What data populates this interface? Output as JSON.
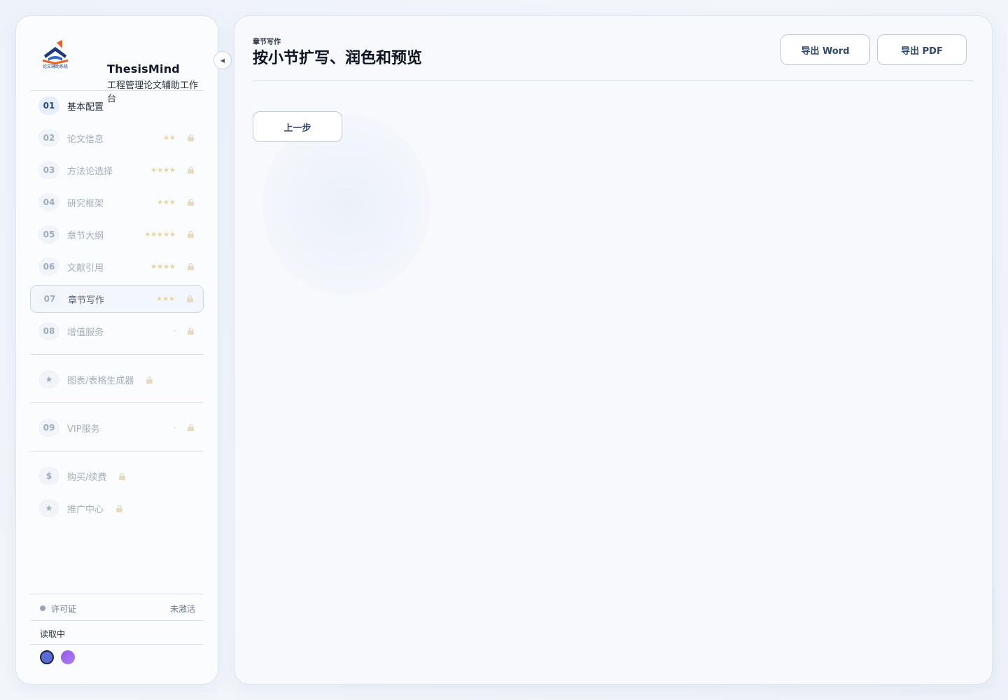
{
  "brand": {
    "title": "ThesisMind",
    "subtitle": "工程管理论文辅助工作台",
    "logo_text": "论文辅助系统"
  },
  "sidebar": {
    "collapse_icon": "chevron-left-icon",
    "steps": [
      {
        "num": "01",
        "label": "基本配置",
        "stars": "",
        "locked": false
      },
      {
        "num": "02",
        "label": "论文信息",
        "stars": "★★",
        "locked": true
      },
      {
        "num": "03",
        "label": "方法论选择",
        "stars": "★★★★",
        "locked": true
      },
      {
        "num": "04",
        "label": "研究框架",
        "stars": "★★★",
        "locked": true
      },
      {
        "num": "05",
        "label": "章节大纲",
        "stars": "★★★★★",
        "locked": true
      },
      {
        "num": "06",
        "label": "文献引用",
        "stars": "★★★★",
        "locked": true
      },
      {
        "num": "07",
        "label": "章节写作",
        "stars": "★★★",
        "locked": true
      },
      {
        "num": "08",
        "label": "增值服务",
        "chevron": "›",
        "locked": true
      }
    ],
    "tools": [
      {
        "icon": "★",
        "label": "图表/表格生成器",
        "locked": true
      }
    ],
    "vip": {
      "num": "09",
      "label": "VIP服务",
      "chevron": "›",
      "locked": true
    },
    "extras": [
      {
        "icon": "$",
        "label": "购买/续费",
        "locked": true
      },
      {
        "icon": "★",
        "label": "推广中心",
        "locked": true
      }
    ],
    "license": {
      "label": "许可证",
      "status": "未激活"
    },
    "reading": "读取中",
    "theme_colors": [
      "#5a6bd8",
      "#9b67ee"
    ]
  },
  "main": {
    "eyebrow": "章节写作",
    "title": "按小节扩写、润色和预览",
    "export_word": "导出 Word",
    "export_pdf": "导出 PDF",
    "prev_step": "上一步"
  }
}
